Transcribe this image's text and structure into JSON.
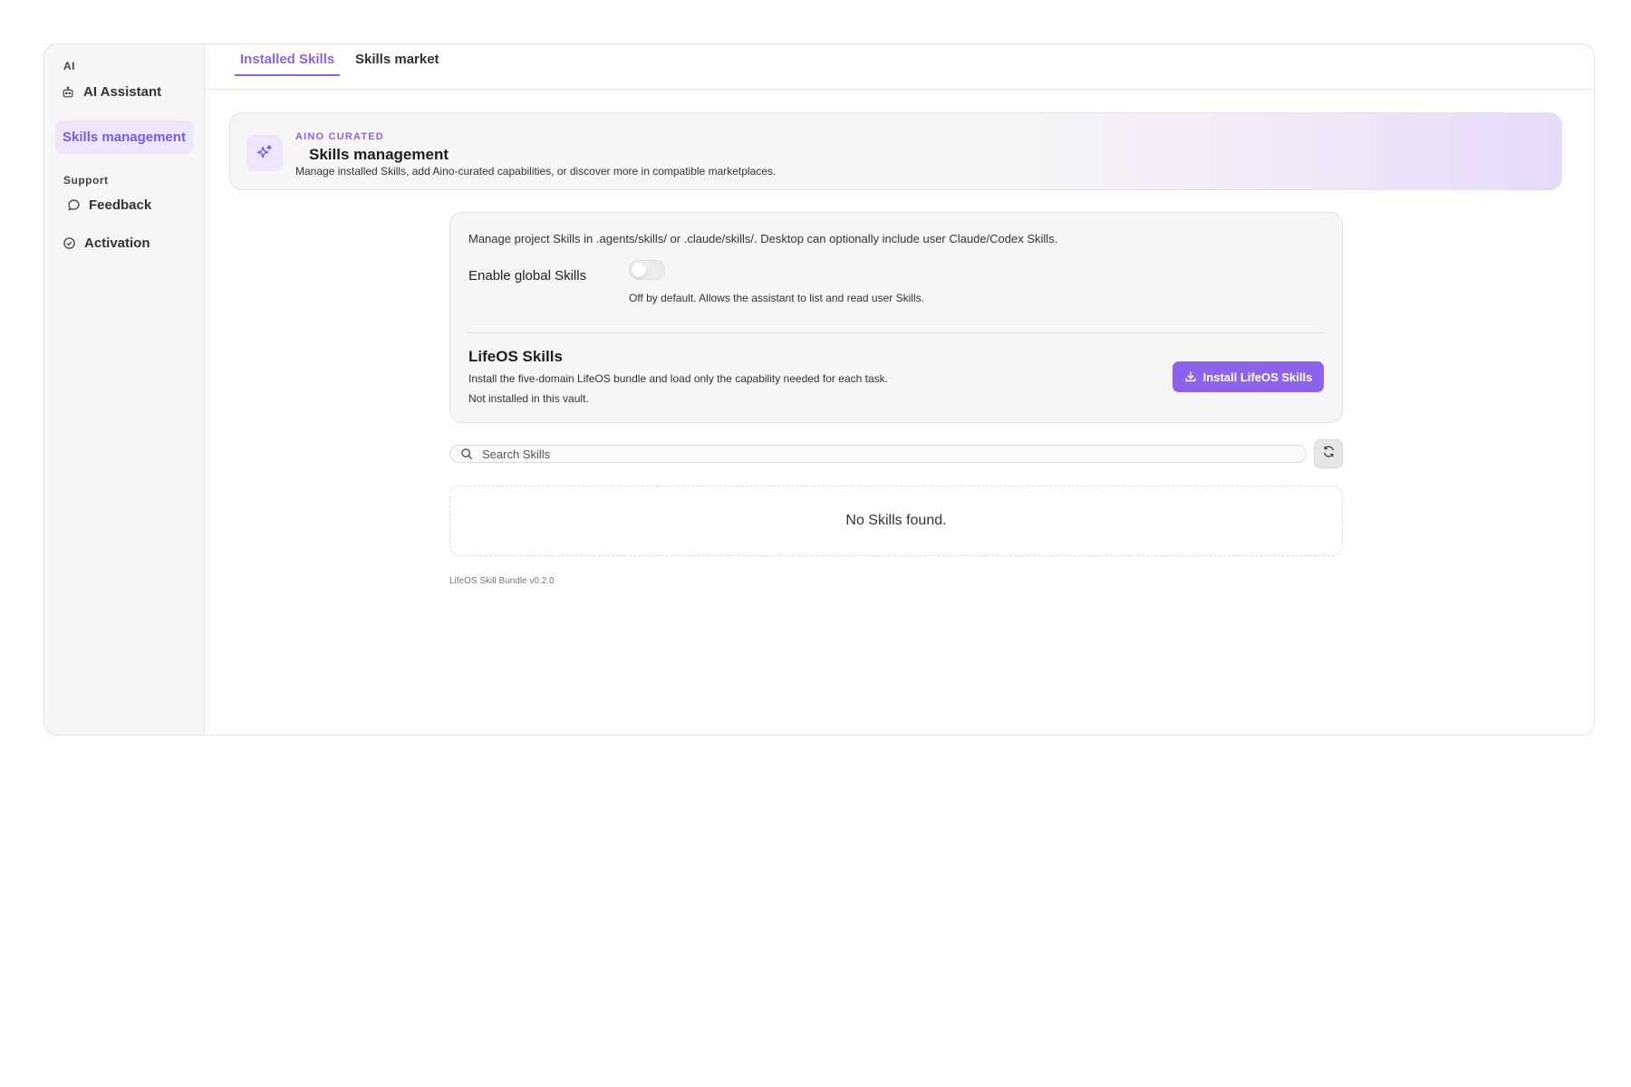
{
  "sidebar": {
    "sections": [
      {
        "label": "AI"
      },
      {
        "label": "Support"
      }
    ],
    "items": [
      {
        "label": "AI Assistant",
        "icon": "robot-icon"
      },
      {
        "label": "Skills management",
        "active": true
      },
      {
        "label": "Feedback",
        "icon": "chat-bubble-icon"
      },
      {
        "label": "Activation",
        "icon": "check-circle-icon"
      }
    ]
  },
  "tabs": [
    {
      "label": "Installed Skills",
      "active": true
    },
    {
      "label": "Skills market",
      "active": false
    }
  ],
  "hero": {
    "eyebrow": "AINO CURATED",
    "title": "Skills management",
    "description": "Manage installed Skills, add Aino-curated capabilities, or discover more in compatible marketplaces.",
    "icon": "sparkles-icon"
  },
  "settings": {
    "intro": "Manage project Skills in .agents/skills/ or .claude/skills/. Desktop can optionally include user Claude/Codex Skills.",
    "global_toggle": {
      "label": "Enable global Skills",
      "enabled": false,
      "help": "Off by default. Allows the assistant to list and read user Skills."
    },
    "lifeos": {
      "title": "LifeOS Skills",
      "description": "Install the five-domain LifeOS bundle and load only the capability needed for each task.",
      "status": "Not installed in this vault.",
      "install_label": "Install LifeOS Skills"
    }
  },
  "search": {
    "placeholder": "Search Skills",
    "value": ""
  },
  "empty_state": "No Skills found.",
  "footer": {
    "version": "LifeOS Skill Bundle v0.2.0"
  },
  "colors": {
    "accent": "#8d63ec",
    "accent_light": "#ebe6fb"
  }
}
